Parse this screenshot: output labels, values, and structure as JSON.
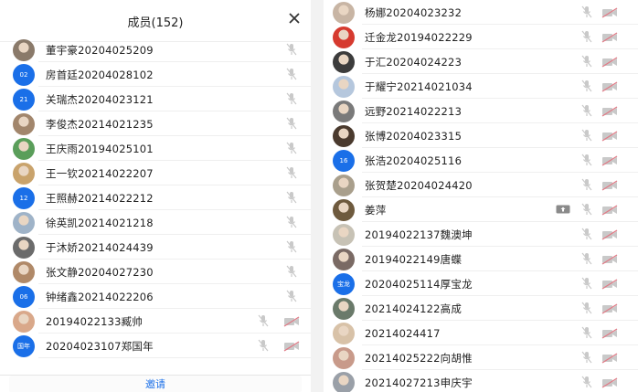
{
  "left": {
    "title": "成员(152)",
    "invite_label": "邀请",
    "members": [
      {
        "name": "董宇豪20204025209",
        "avatar": {
          "kind": "photo",
          "color": "#8a7a6a"
        },
        "camera": false
      },
      {
        "name": "房首廷20204028102",
        "avatar": {
          "kind": "badge",
          "text": "02",
          "color": "#1a6fe8"
        },
        "camera": false
      },
      {
        "name": "关瑞杰20204023121",
        "avatar": {
          "kind": "badge",
          "text": "21",
          "color": "#1a6fe8"
        },
        "camera": false
      },
      {
        "name": "李俊杰20214021235",
        "avatar": {
          "kind": "photo",
          "color": "#a2866c"
        },
        "camera": false
      },
      {
        "name": "王庆雨20194025101",
        "avatar": {
          "kind": "photo",
          "color": "#5a9e5a"
        },
        "camera": false
      },
      {
        "name": "王一钦20214022207",
        "avatar": {
          "kind": "photo",
          "color": "#c9a36c"
        },
        "camera": false
      },
      {
        "name": "王照赫20214022212",
        "avatar": {
          "kind": "badge",
          "text": "12",
          "color": "#1a6fe8"
        },
        "camera": false
      },
      {
        "name": "徐英凯20214021218",
        "avatar": {
          "kind": "photo",
          "color": "#9fb3c8"
        },
        "camera": false
      },
      {
        "name": "于沐娇20214024439",
        "avatar": {
          "kind": "photo",
          "color": "#6b6b6b"
        },
        "camera": false
      },
      {
        "name": "张文静20204027230",
        "avatar": {
          "kind": "photo",
          "color": "#b08968"
        },
        "camera": false
      },
      {
        "name": "钟绪鑫20214022206",
        "avatar": {
          "kind": "badge",
          "text": "06",
          "color": "#1a6fe8"
        },
        "camera": false
      },
      {
        "name": "20194022133臧帅",
        "avatar": {
          "kind": "photo",
          "color": "#d9a88a"
        },
        "camera": true
      },
      {
        "name": "20204023107郑国年",
        "avatar": {
          "kind": "badge",
          "text": "国年",
          "color": "#1a6fe8"
        },
        "camera": true
      }
    ]
  },
  "right": {
    "members": [
      {
        "name": "杨娜20204023232",
        "avatar": {
          "kind": "photo",
          "color": "#c8b5a4"
        },
        "camera": true,
        "screen": false
      },
      {
        "name": "迁金龙20194022229",
        "avatar": {
          "kind": "photo",
          "color": "#d63a2f"
        },
        "camera": true,
        "screen": false
      },
      {
        "name": "于汇20204024223",
        "avatar": {
          "kind": "photo",
          "color": "#3c3c3c"
        },
        "camera": true,
        "screen": false
      },
      {
        "name": "于耀宁20214021034",
        "avatar": {
          "kind": "photo",
          "color": "#b5c7dd"
        },
        "camera": true,
        "screen": false
      },
      {
        "name": "远野20214022213",
        "avatar": {
          "kind": "photo",
          "color": "#7a7a7a"
        },
        "camera": true,
        "screen": false
      },
      {
        "name": "张博20204023315",
        "avatar": {
          "kind": "photo",
          "color": "#4a3a2e"
        },
        "camera": true,
        "screen": false
      },
      {
        "name": "张浩20204025116",
        "avatar": {
          "kind": "badge",
          "text": "16",
          "color": "#1a6fe8"
        },
        "camera": true,
        "screen": false
      },
      {
        "name": "张贺楚20204024420",
        "avatar": {
          "kind": "photo",
          "color": "#a99f8c"
        },
        "camera": true,
        "screen": false
      },
      {
        "name": "姜萍",
        "avatar": {
          "kind": "photo",
          "color": "#6e5a3e"
        },
        "camera": true,
        "screen": true
      },
      {
        "name": "20194022137魏澳坤",
        "avatar": {
          "kind": "photo",
          "color": "#c7c2b5"
        },
        "camera": true,
        "screen": false
      },
      {
        "name": "20194022149唐蝶",
        "avatar": {
          "kind": "photo",
          "color": "#7a6a64"
        },
        "camera": true,
        "screen": false
      },
      {
        "name": "20204025114厚宝龙",
        "avatar": {
          "kind": "badge",
          "text": "宝龙",
          "color": "#1a6fe8"
        },
        "camera": true,
        "screen": false
      },
      {
        "name": "20214024122高成",
        "avatar": {
          "kind": "photo",
          "color": "#6a7a6a"
        },
        "camera": true,
        "screen": false
      },
      {
        "name": "20214024417",
        "avatar": {
          "kind": "photo",
          "color": "#d8c2a8"
        },
        "camera": true,
        "screen": false
      },
      {
        "name": "20214025222向胡惟",
        "avatar": {
          "kind": "photo",
          "color": "#c89a8a"
        },
        "camera": true,
        "screen": false
      },
      {
        "name": "20214027213申庆宇",
        "avatar": {
          "kind": "photo",
          "color": "#9aa0a8"
        },
        "camera": true,
        "screen": false
      }
    ]
  },
  "icons": {
    "close": "close-icon",
    "mic_muted": "mic-muted-icon",
    "camera_off": "camera-off-icon",
    "screen_share": "screen-share-icon"
  },
  "colors": {
    "accent": "#1a6fe8",
    "icon_gray": "#c9c9c9",
    "camera_red": "#e07a86",
    "screen_gray": "#8a8a8a"
  }
}
